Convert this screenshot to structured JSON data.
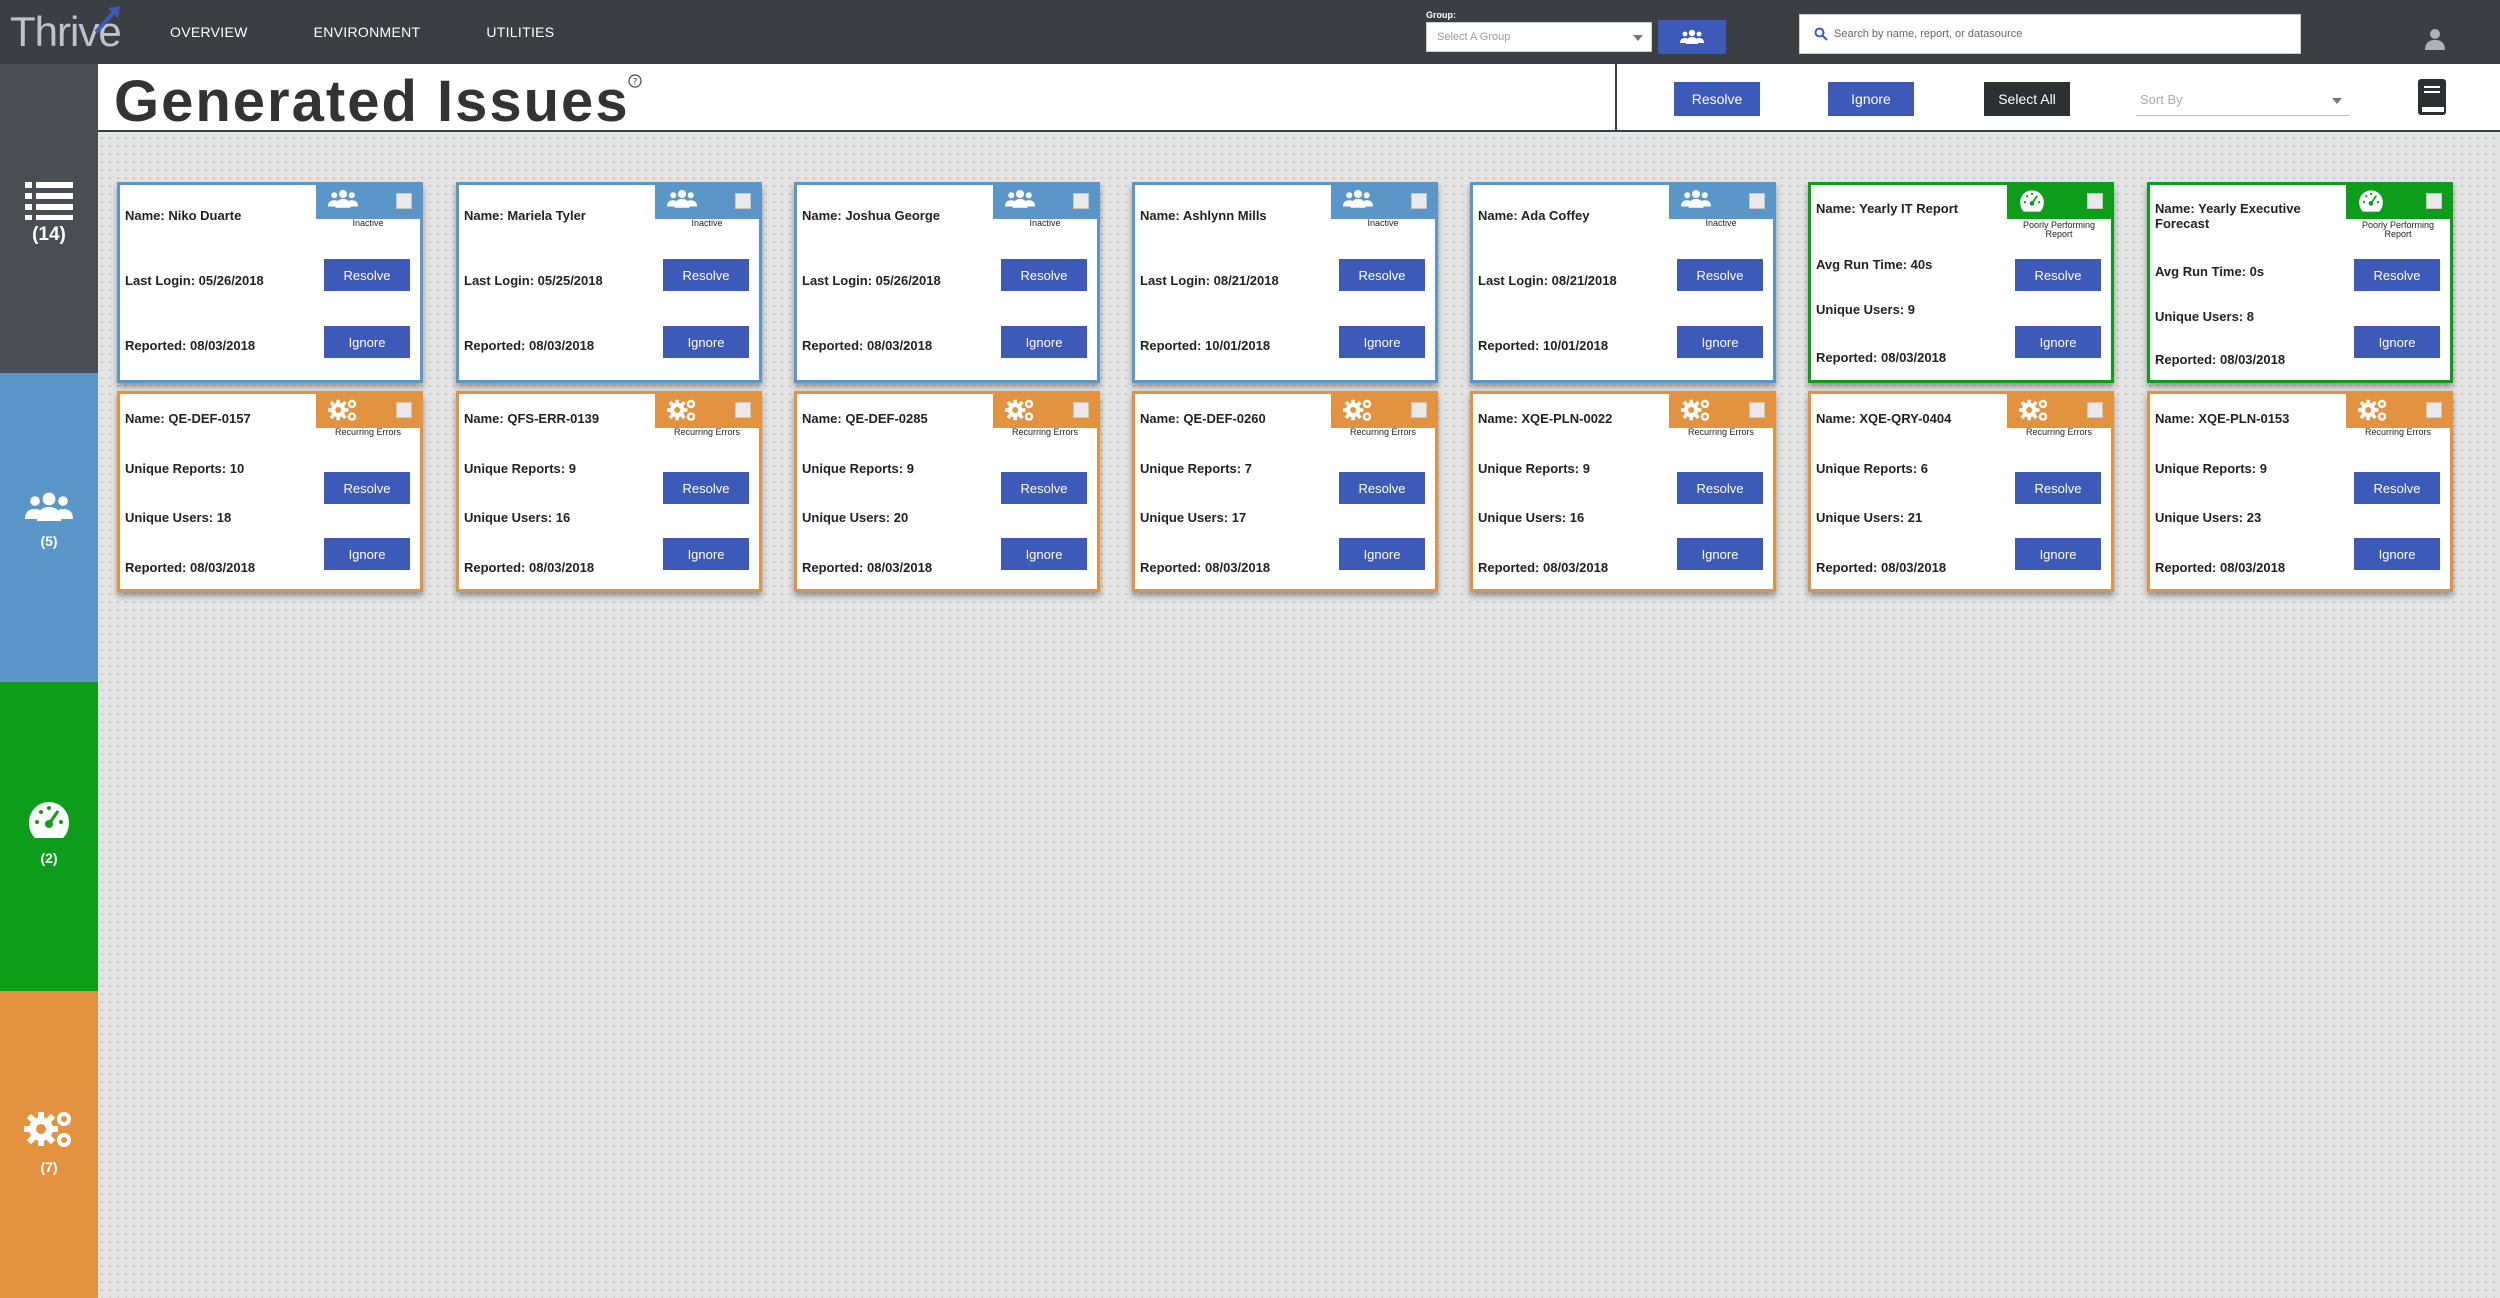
{
  "app": {
    "logo": "Thrive"
  },
  "nav": {
    "items": [
      "OVERVIEW",
      "ENVIRONMENT",
      "UTILITIES"
    ]
  },
  "group": {
    "label": "Group:",
    "placeholder": "Select A Group"
  },
  "search": {
    "placeholder": "Search by name, report, or datasource"
  },
  "header": {
    "title": "Generated Issues",
    "title_sup": "?",
    "resolve_label": "Resolve",
    "ignore_label": "Ignore",
    "select_all_label": "Select All",
    "sort_placeholder": "Sort By"
  },
  "sidebar": {
    "tabs": [
      {
        "icon": "list-icon",
        "count": "(14)"
      },
      {
        "icon": "users-icon",
        "count": "(5)"
      },
      {
        "icon": "gauge-icon",
        "count": "(2)"
      },
      {
        "icon": "gears-icon",
        "count": "(7)"
      }
    ]
  },
  "colors": {
    "topbar": "#3b3e42",
    "inactive": "#5b96c9",
    "poorly_performing": "#0d9d1a",
    "recurring_errors": "#e39340",
    "button": "#3d5ab8"
  },
  "cards_row1": [
    {
      "type": "blue",
      "icon": "users-icon",
      "badge": "Inactive",
      "lines": [
        "Name: Niko Duarte",
        "Last Login: 05/26/2018",
        "Reported: 08/03/2018"
      ],
      "resolve": "Resolve",
      "ignore": "Ignore"
    },
    {
      "type": "blue",
      "icon": "users-icon",
      "badge": "Inactive",
      "lines": [
        "Name: Mariela Tyler",
        "Last Login: 05/25/2018",
        "Reported: 08/03/2018"
      ],
      "resolve": "Resolve",
      "ignore": "Ignore"
    },
    {
      "type": "blue",
      "icon": "users-icon",
      "badge": "Inactive",
      "lines": [
        "Name: Joshua George",
        "Last Login: 05/26/2018",
        "Reported: 08/03/2018"
      ],
      "resolve": "Resolve",
      "ignore": "Ignore"
    },
    {
      "type": "blue",
      "icon": "users-icon",
      "badge": "Inactive",
      "lines": [
        "Name: Ashlynn Mills",
        "Last Login: 08/21/2018",
        "Reported: 10/01/2018"
      ],
      "resolve": "Resolve",
      "ignore": "Ignore"
    },
    {
      "type": "blue",
      "icon": "users-icon",
      "badge": "Inactive",
      "lines": [
        "Name: Ada Coffey",
        "Last Login: 08/21/2018",
        "Reported: 10/01/2018"
      ],
      "resolve": "Resolve",
      "ignore": "Ignore"
    },
    {
      "type": "green",
      "icon": "gauge-icon",
      "badge": "Poorly Performing Report",
      "lines": [
        "Name: Yearly IT Report",
        "Avg Run Time: 40s",
        "Unique Users: 9",
        "Reported: 08/03/2018"
      ],
      "resolve": "Resolve",
      "ignore": "Ignore"
    },
    {
      "type": "green",
      "icon": "gauge-icon",
      "badge": "Poorly Performing Report",
      "lines": [
        "Name: Yearly Executive Forecast",
        "Avg Run Time: 0s",
        "Unique Users: 8",
        "Reported: 08/03/2018"
      ],
      "resolve": "Resolve",
      "ignore": "Ignore"
    }
  ],
  "cards_row2": [
    {
      "type": "orange",
      "icon": "gears-icon",
      "badge": "Recurring Errors",
      "lines": [
        "Name: QE-DEF-0157",
        "Unique Reports: 10",
        "Unique Users: 18",
        "Reported: 08/03/2018"
      ],
      "resolve": "Resolve",
      "ignore": "Ignore"
    },
    {
      "type": "orange",
      "icon": "gears-icon",
      "badge": "Recurring Errors",
      "lines": [
        "Name: QFS-ERR-0139",
        "Unique Reports: 9",
        "Unique Users: 16",
        "Reported: 08/03/2018"
      ],
      "resolve": "Resolve",
      "ignore": "Ignore"
    },
    {
      "type": "orange",
      "icon": "gears-icon",
      "badge": "Recurring Errors",
      "lines": [
        "Name: QE-DEF-0285",
        "Unique Reports: 9",
        "Unique Users: 20",
        "Reported: 08/03/2018"
      ],
      "resolve": "Resolve",
      "ignore": "Ignore"
    },
    {
      "type": "orange",
      "icon": "gears-icon",
      "badge": "Recurring Errors",
      "lines": [
        "Name: QE-DEF-0260",
        "Unique Reports: 7",
        "Unique Users: 17",
        "Reported: 08/03/2018"
      ],
      "resolve": "Resolve",
      "ignore": "Ignore"
    },
    {
      "type": "orange",
      "icon": "gears-icon",
      "badge": "Recurring Errors",
      "lines": [
        "Name: XQE-PLN-0022",
        "Unique Reports: 9",
        "Unique Users: 16",
        "Reported: 08/03/2018"
      ],
      "resolve": "Resolve",
      "ignore": "Ignore"
    },
    {
      "type": "orange",
      "icon": "gears-icon",
      "badge": "Recurring Errors",
      "lines": [
        "Name: XQE-QRY-0404",
        "Unique Reports: 6",
        "Unique Users: 21",
        "Reported: 08/03/2018"
      ],
      "resolve": "Resolve",
      "ignore": "Ignore"
    },
    {
      "type": "orange",
      "icon": "gears-icon",
      "badge": "Recurring Errors",
      "lines": [
        "Name: XQE-PLN-0153",
        "Unique Reports: 9",
        "Unique Users: 23",
        "Reported: 08/03/2018"
      ],
      "resolve": "Resolve",
      "ignore": "Ignore"
    }
  ]
}
